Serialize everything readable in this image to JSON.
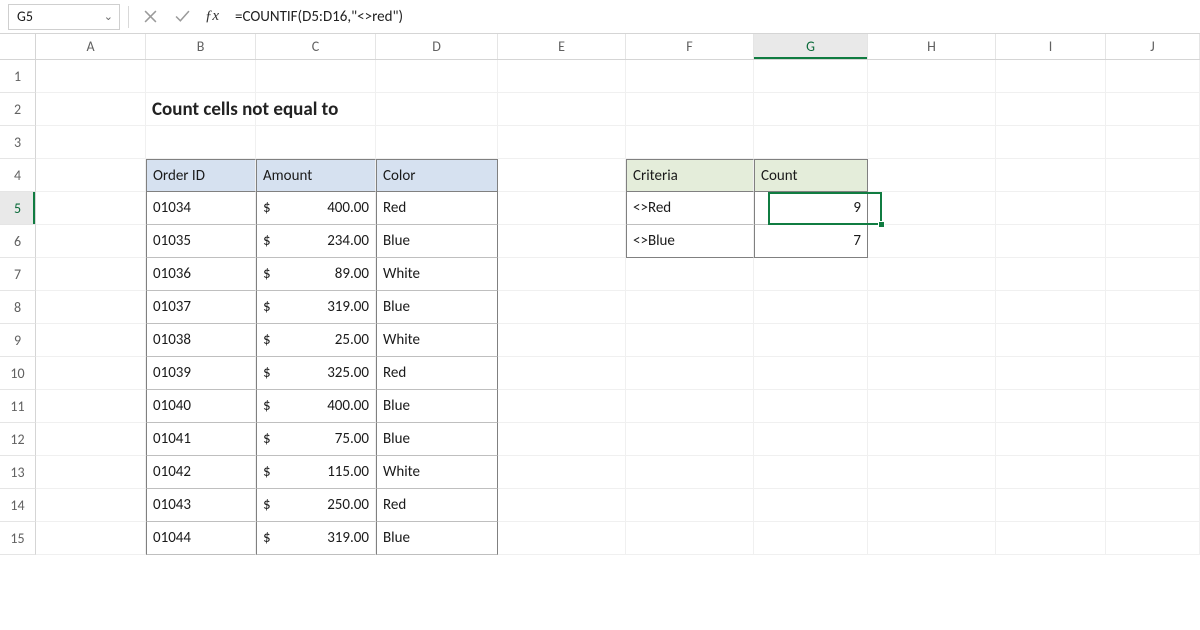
{
  "namebox": {
    "value": "G5"
  },
  "formula_bar": {
    "formula": "=COUNTIF(D5:D16,\"<>red\")"
  },
  "columns": [
    "A",
    "B",
    "C",
    "D",
    "E",
    "F",
    "G",
    "H",
    "I",
    "J"
  ],
  "rows": [
    1,
    2,
    3,
    4,
    5,
    6,
    7,
    8,
    9,
    10,
    11,
    12,
    13,
    14,
    15
  ],
  "active": {
    "col": "G",
    "row": 5
  },
  "title": "Count cells not equal to",
  "table": {
    "headers": {
      "order": "Order ID",
      "amount": "Amount",
      "color": "Color"
    },
    "rows": [
      {
        "order": "01034",
        "amount": "400.00",
        "color": "Red"
      },
      {
        "order": "01035",
        "amount": "234.00",
        "color": "Blue"
      },
      {
        "order": "01036",
        "amount": "89.00",
        "color": "White"
      },
      {
        "order": "01037",
        "amount": "319.00",
        "color": "Blue"
      },
      {
        "order": "01038",
        "amount": "25.00",
        "color": "White"
      },
      {
        "order": "01039",
        "amount": "325.00",
        "color": "Red"
      },
      {
        "order": "01040",
        "amount": "400.00",
        "color": "Blue"
      },
      {
        "order": "01041",
        "amount": "75.00",
        "color": "Blue"
      },
      {
        "order": "01042",
        "amount": "115.00",
        "color": "White"
      },
      {
        "order": "01043",
        "amount": "250.00",
        "color": "Red"
      },
      {
        "order": "01044",
        "amount": "319.00",
        "color": "Blue"
      }
    ]
  },
  "criteria": {
    "headers": {
      "criteria": "Criteria",
      "count": "Count"
    },
    "rows": [
      {
        "criteria": "<>Red",
        "count": "9"
      },
      {
        "criteria": "<>Blue",
        "count": "7"
      }
    ]
  },
  "currency_symbol": "$"
}
